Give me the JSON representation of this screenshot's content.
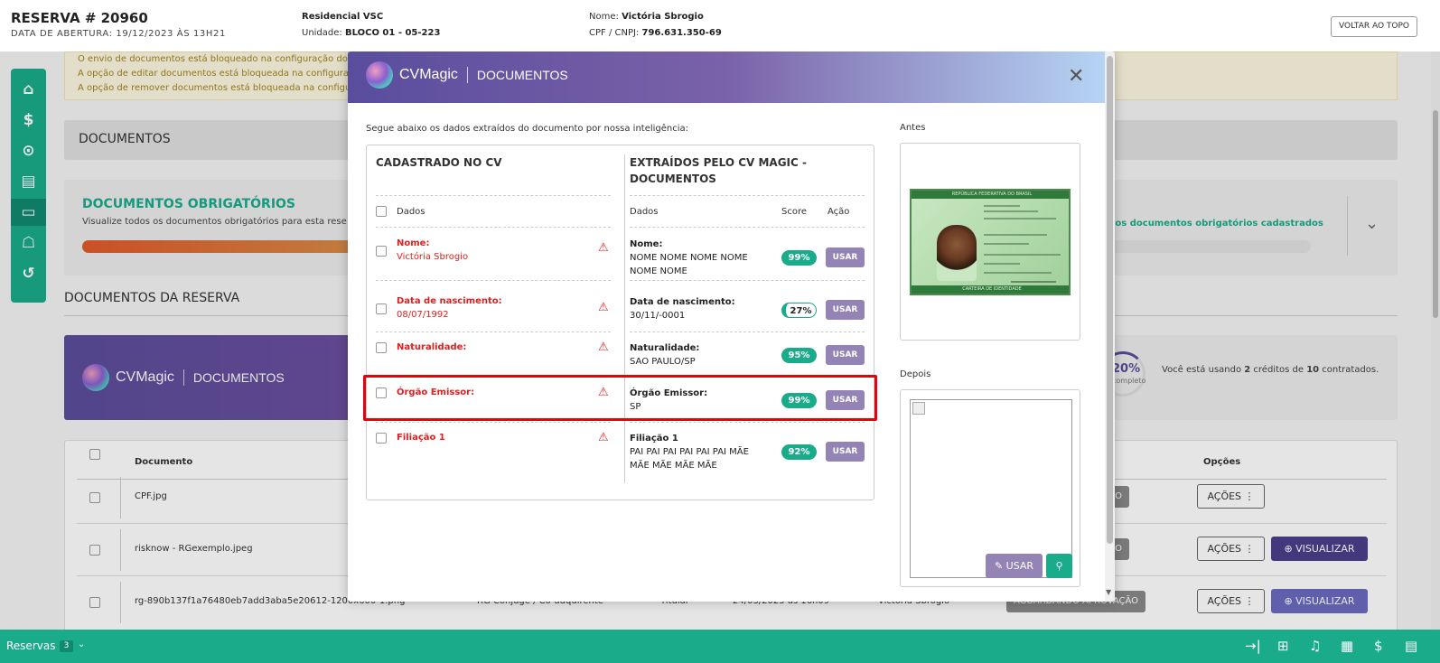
{
  "header": {
    "reserva": "RESERVA # 20960",
    "abertura": "DATA DE ABERTURA: 19/12/2023 ÀS 13H21",
    "empreendimento": "Residencial VSC",
    "unidade_label": "Unidade:",
    "unidade": "BLOCO 01 - 05-223",
    "nome_label": "Nome:",
    "nome": "Victória Sbrogio",
    "cpf_label": "CPF / CNPJ:",
    "cpf": "796.631.350-69",
    "voltar": "VOLTAR AO TOPO"
  },
  "warnings": [
    "O envio de documentos está bloqueado na configuração do",
    "A opção de editar documentos está bloqueada na configura",
    "A opção de remover documentos está bloqueada na configur"
  ],
  "documentos_title": "DOCUMENTOS",
  "obrigatorios": {
    "title": "DOCUMENTOS OBRIGATÓRIOS",
    "subtitle": "Visualize todos os documentos obrigatórios para esta rese",
    "right_text": "los documentos obrigatórios cadastrados"
  },
  "docs_reserva_title": "DOCUMENTOS DA RESERVA",
  "cv_banner": {
    "percent": "20%",
    "percent_label": "completo",
    "credits_pre": "Você está usando ",
    "credits_used": "2",
    "credits_mid": " créditos de ",
    "credits_total": "10",
    "credits_post": " contratados."
  },
  "logo": {
    "name": "CVMagic",
    "section": "DOCUMENTOS"
  },
  "table": {
    "col_documento": "Documento",
    "col_opcoes": "Opções",
    "rows": [
      {
        "name": "CPF.jpg",
        "status": "AÇÃO",
        "acoes": "AÇÕES ⋮"
      },
      {
        "name": "risknow - RGexemplo.jpeg",
        "status": "AÇÃO",
        "acoes": "AÇÕES ⋮",
        "ver": "VISUALIZAR"
      },
      {
        "name": "rg-890b137f1a76480eb7add3aba5e20612-1200x600-1.png",
        "tipo": "RG Cônjuge / Co-adquirente",
        "titular": "Titular",
        "data": "24/03/2025 às 16h09",
        "user": "Victória Sbrogio",
        "status": "AGUARDANDO APROVAÇÃO",
        "acoes": "AÇÕES ⋮",
        "ver": "VISUALIZAR"
      }
    ]
  },
  "modal": {
    "intro": "Segue abaixo os dados extraídos do documento por nossa inteligência:",
    "col_left": "CADASTRADO NO CV",
    "col_right_1": "EXTRAÍDOS PELO CV MAGIC -",
    "col_right_2": "DOCUMENTOS",
    "dados": "Dados",
    "score": "Score",
    "acao": "Ação",
    "usar": "USAR",
    "fields": [
      {
        "label": "Nome:",
        "value": "Victória Sbrogio",
        "ex_label": "Nome:",
        "ex_lines": [
          "NOME NOME NOME NOME",
          "NOME NOME"
        ],
        "score": "99%"
      },
      {
        "label": "Data de nascimento:",
        "value": "08/07/1992",
        "ex_label": "Data de nascimento:",
        "ex_lines": [
          "30/11/-0001"
        ],
        "score": "27%"
      },
      {
        "label": "Naturalidade:",
        "value": "",
        "ex_label": "Naturalidade:",
        "ex_lines": [
          "SAO PAULO/SP"
        ],
        "score": "95%"
      },
      {
        "label": "Órgão Emissor:",
        "value": "",
        "ex_label": "Órgão Emissor:",
        "ex_lines": [
          "SP"
        ],
        "score": "99%"
      },
      {
        "label": "Filiação 1",
        "value": "",
        "ex_label": "Filiação 1",
        "ex_lines": [
          "PAI PAI PAI PAI PAI PAI MÃE",
          "MÃE MÃE MÃE MÃE"
        ],
        "score": "92%"
      }
    ],
    "antes": "Antes",
    "depois": "Depois",
    "btn_usar": "USAR",
    "id_card": {
      "top": "REPÚBLICA FEDERATIVA DO BRASIL",
      "bottom": "CARTEIRA DE IDENTIDADE"
    }
  },
  "footer": {
    "reservas": "Reservas",
    "count": "3"
  }
}
